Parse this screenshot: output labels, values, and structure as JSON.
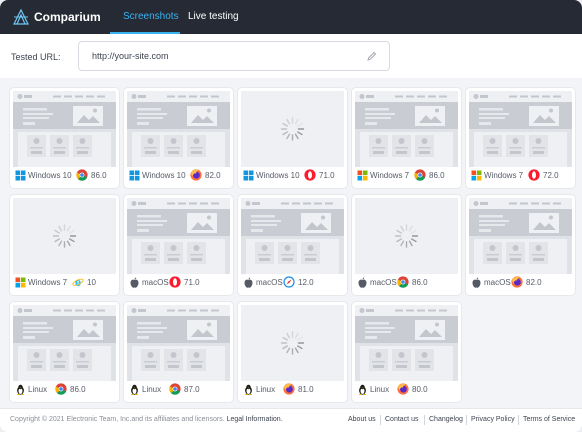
{
  "app": {
    "name": "Comparium",
    "logo_icon": "comparium-logo-icon"
  },
  "nav": {
    "tabs": [
      {
        "label": "Screenshots",
        "active": true
      },
      {
        "label": "Live testing",
        "active": false
      }
    ]
  },
  "url_bar": {
    "label": "Tested URL:",
    "value": "http://your-site.com",
    "edit_icon": "pencil-icon"
  },
  "colors": {
    "accent": "#39b3f0",
    "topbar": "#252a34"
  },
  "screenshots": [
    {
      "os": "Windows 10",
      "browser": "chrome",
      "version": "86.0",
      "state": "loaded"
    },
    {
      "os": "Windows 10",
      "browser": "firefox",
      "version": "82.0",
      "state": "loaded"
    },
    {
      "os": "Windows 10",
      "browser": "opera",
      "version": "71.0",
      "state": "loading"
    },
    {
      "os": "Windows 7",
      "browser": "chrome",
      "version": "86.0",
      "state": "loaded"
    },
    {
      "os": "Windows 7",
      "browser": "opera",
      "version": "72.0",
      "state": "loaded"
    },
    {
      "os": "Windows 7",
      "browser": "ie",
      "version": "10",
      "state": "loading"
    },
    {
      "os": "macOS",
      "browser": "opera",
      "version": "71.0",
      "state": "loaded"
    },
    {
      "os": "macOS",
      "browser": "safari",
      "version": "12.0",
      "state": "loaded"
    },
    {
      "os": "macOS",
      "browser": "chrome",
      "version": "86.0",
      "state": "loading"
    },
    {
      "os": "macOS",
      "browser": "firefox",
      "version": "82.0",
      "state": "loaded"
    },
    {
      "os": "Linux",
      "browser": "chrome",
      "version": "86.0",
      "state": "loaded"
    },
    {
      "os": "Linux",
      "browser": "chrome",
      "version": "87.0",
      "state": "loaded"
    },
    {
      "os": "Linux",
      "browser": "firefox",
      "version": "81.0",
      "state": "loading"
    },
    {
      "os": "Linux",
      "browser": "firefox",
      "version": "80.0",
      "state": "loaded"
    }
  ],
  "footer": {
    "copyright": "Copyright © 2021 Electronic Team, Inc.and its affiliates and licensors.",
    "legal": "Legal Information.",
    "links": [
      "About us",
      "Contact us",
      "Changelog",
      "Privacy Policy",
      "Terms of Service"
    ]
  }
}
